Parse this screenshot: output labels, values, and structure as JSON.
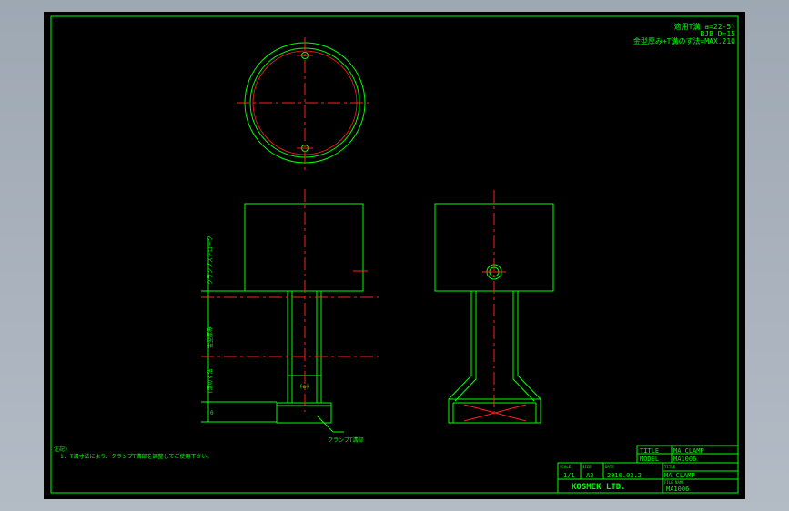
{
  "colors": {
    "line": "#00ff00",
    "center": "#ff2020",
    "text": "#00ff00",
    "paper": "#000000",
    "desktop": "#a7b0bb"
  },
  "notes_top": {
    "line1": "適用T溝 a=22-5)",
    "line2": "BJB D=15",
    "line3": "金型厚み+T溝のす法=MAX.210"
  },
  "dims": {
    "clamp_stroke": "クランプストローク",
    "mold_thickness": "金型厚み",
    "tslot": "T溝のす法",
    "zero": "0",
    "paren_a": "(a)",
    "leader_label": "クランプT溝部"
  },
  "remarks": {
    "heading": "注記)",
    "line1": "1. T溝寸法により、クランプT溝部を調整してご使用下さい。"
  },
  "title_block": {
    "title_label": "TITLE",
    "title_value": "MA CLAMP",
    "model_label": "MODEL",
    "model_value": "MA1006",
    "scale_label": "SCALE",
    "scale_value": "1/1",
    "size_label": "SIZE",
    "size_value": "A3",
    "date_label": "DATE",
    "date_value": "2010.03.2",
    "title2_label": "TITLE",
    "title2_value": "MA CLAMP",
    "company": "KOSMEK LTD.",
    "file_label": "FILE NAME",
    "file_value": "MA1006"
  }
}
